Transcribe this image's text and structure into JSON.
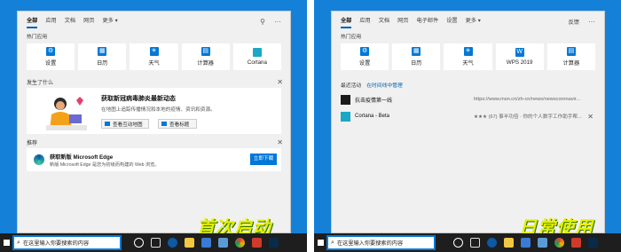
{
  "left": {
    "tabs": [
      "全部",
      "应用",
      "文档",
      "网页",
      "更多 ▾"
    ],
    "pinned_title": "热门应用",
    "apps": [
      {
        "label": "设置",
        "icon": "settings-icon"
      },
      {
        "label": "日历",
        "icon": "calendar-icon"
      },
      {
        "label": "天气",
        "icon": "weather-icon"
      },
      {
        "label": "计算器",
        "icon": "calculator-icon"
      },
      {
        "label": "Cortana",
        "icon": "cortana-icon"
      }
    ],
    "happening_title": "发生了什么",
    "news_title": "获取新冠病毒肺炎最新动态",
    "news_desc": "在地图上追踪传播情况和本地的疫情、资讯和资源。",
    "news_btn_map": "查看互动地图",
    "news_btn_headlines": "查看标题",
    "recommend_title": "推荐",
    "rec_name": "获取新版 Microsoft Edge",
    "rec_desc": "新版 Microsoft Edge 是您为初级而构建的 Web 浏览。",
    "rec_download": "立即下载",
    "banner": "首次启动"
  },
  "right": {
    "tabs": [
      "全部",
      "应用",
      "文档",
      "网页",
      "电子邮件",
      "设置",
      "更多 ▾"
    ],
    "feedback": "反馈",
    "pinned_title": "热门应用",
    "apps": [
      {
        "label": "设置",
        "icon": "settings-icon"
      },
      {
        "label": "日历",
        "icon": "calendar-icon"
      },
      {
        "label": "天气",
        "icon": "weather-icon"
      },
      {
        "label": "WPS 2019",
        "icon": "wps-icon"
      },
      {
        "label": "计算器",
        "icon": "calculator-icon"
      }
    ],
    "recent_label": "最近活动",
    "recent_link": "在时间线中管理",
    "recent": [
      {
        "name": "抗击疫情第一线",
        "url": "https://www.msn.cn/zh-cn/news/newscoronavir..."
      },
      {
        "name": "Cortana - Beta",
        "url": "★★★ (67) 事半功倍 · 你的个人数字工作助手帮..."
      }
    ],
    "banner": "日常使用"
  },
  "taskbar": {
    "search_placeholder": "在这里输入你要搜索的内容"
  },
  "colors": {
    "accent": "#0078d7",
    "desktop": "#1580d8",
    "banner": "#e5f000"
  }
}
